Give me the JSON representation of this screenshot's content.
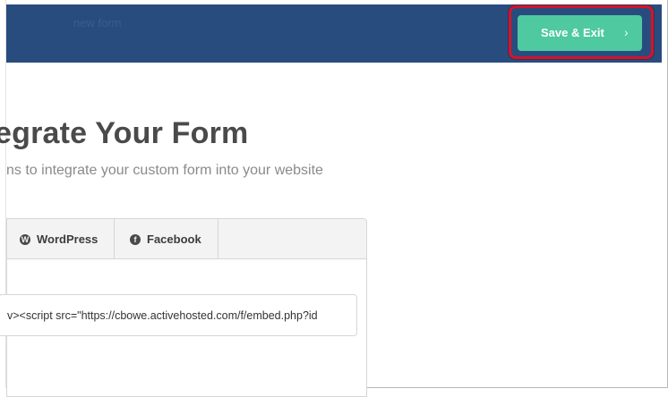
{
  "header": {
    "form_name": "new form",
    "save_label": "Save & Exit",
    "save_chevron": "›"
  },
  "main": {
    "title": "egrate Your Form",
    "subtitle": "ns to integrate your custom form into your website"
  },
  "tabs": [
    {
      "label": "WordPress",
      "icon": "wordpress-icon",
      "glyph": "W"
    },
    {
      "label": "Facebook",
      "icon": "facebook-icon",
      "glyph": "f"
    }
  ],
  "embed": {
    "code": "v><script src=\"https://cbowe.activehosted.com/f/embed.php?id"
  },
  "colors": {
    "header_bg": "#294c7f",
    "save_button_bg": "#4ec9a0",
    "highlight": "#d4142a"
  }
}
